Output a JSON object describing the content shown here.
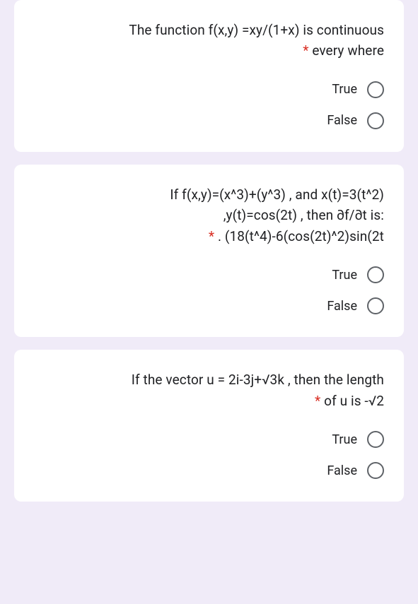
{
  "questions": [
    {
      "text_line1": "The function f(x,y) =xy/(1+x) is continuous",
      "text_line2": "every where",
      "option_true": "True",
      "option_false": "False"
    },
    {
      "text_line1": "If f(x,y)=(x^3)+(y^3) , and x(t)=3(t^2)",
      "text_line2": ",y(t)=cos(2t) , then ∂f/∂t is:",
      "text_line3": ". (18(t^4)-6(cos(2t)^2)sin(2t",
      "option_true": "True",
      "option_false": "False"
    },
    {
      "text_line1": "If the vector u = 2i-3j+√3k , then the length",
      "text_line2": "of u is -√2",
      "option_true": "True",
      "option_false": "False"
    }
  ],
  "required_marker": "*"
}
